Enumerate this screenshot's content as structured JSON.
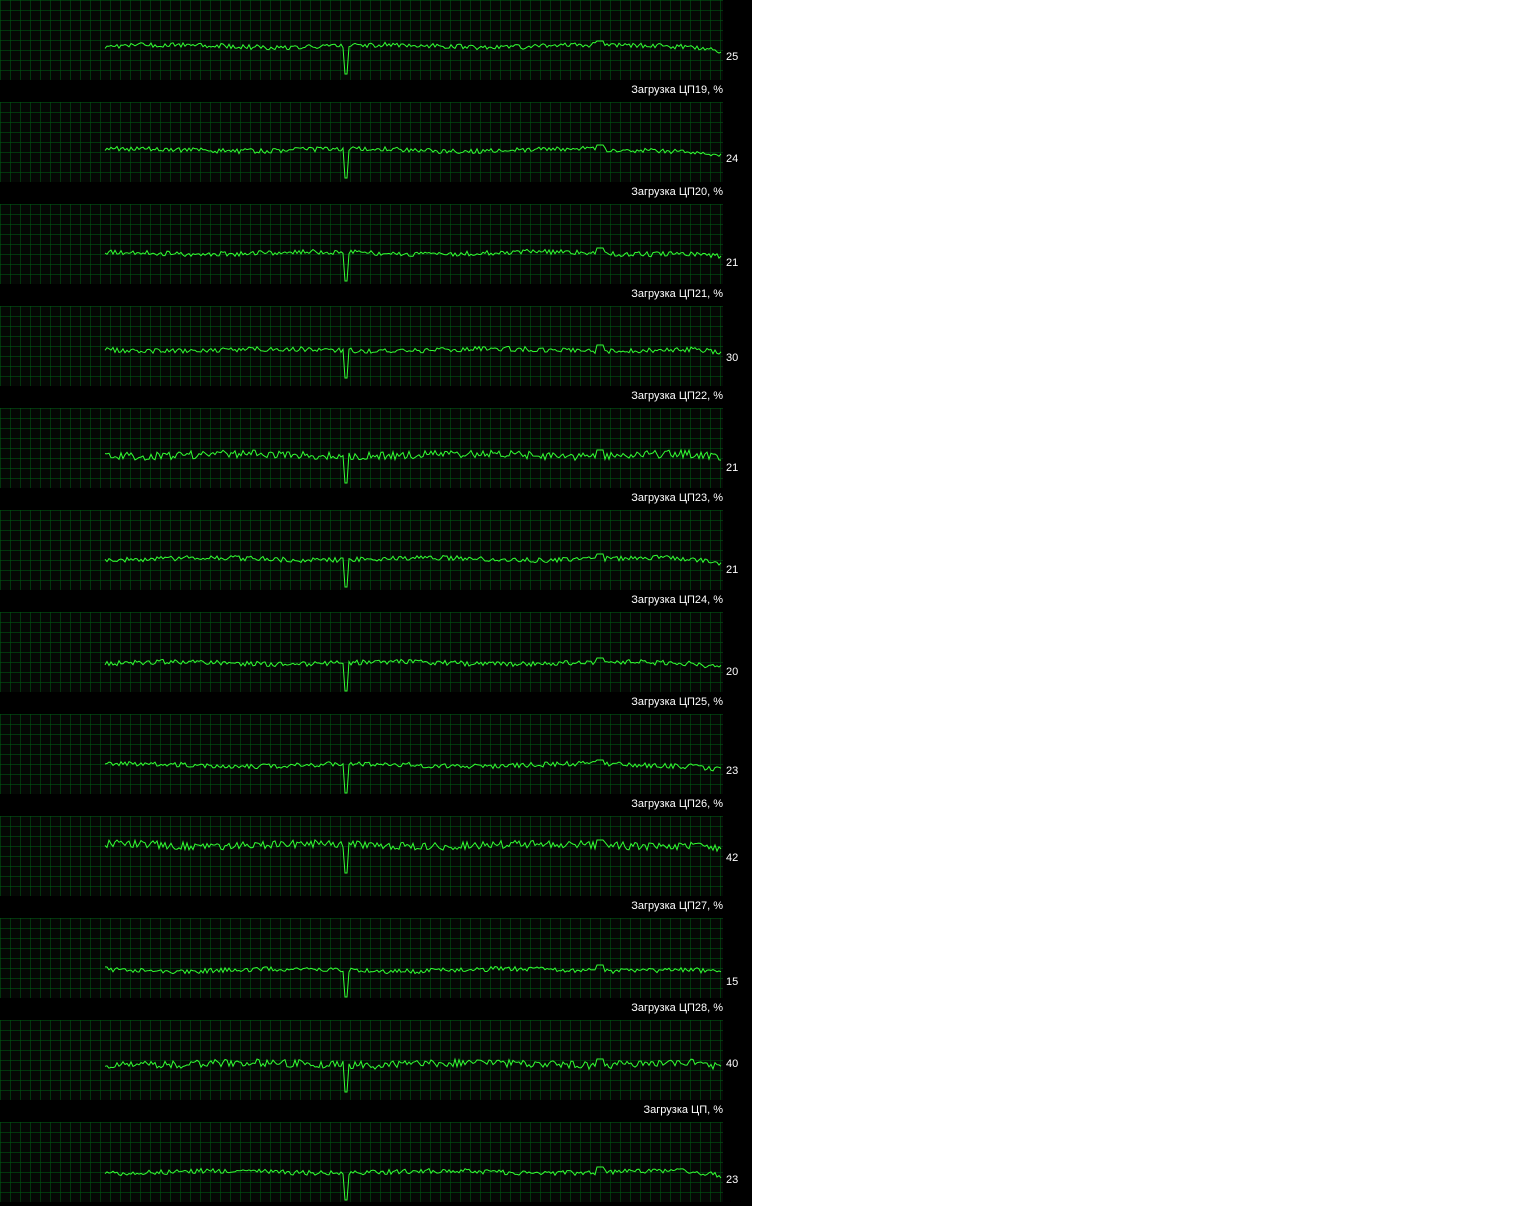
{
  "colors": {
    "background": "#000000",
    "grid": "#0b3a12",
    "line": "#33ff33",
    "text": "#ffffff"
  },
  "graphs": [
    {
      "current_value": "25",
      "title_below": "Загрузка ЦП19, %"
    },
    {
      "current_value": "24",
      "title_below": "Загрузка ЦП20, %"
    },
    {
      "current_value": "21",
      "title_below": "Загрузка ЦП21, %"
    },
    {
      "current_value": "30",
      "title_below": "Загрузка ЦП22, %"
    },
    {
      "current_value": "21",
      "title_below": "Загрузка ЦП23, %"
    },
    {
      "current_value": "21",
      "title_below": "Загрузка ЦП24, %"
    },
    {
      "current_value": "20",
      "title_below": "Загрузка ЦП25, %"
    },
    {
      "current_value": "23",
      "title_below": "Загрузка ЦП26, %"
    },
    {
      "current_value": "42",
      "title_below": "Загрузка ЦП27, %"
    },
    {
      "current_value": "15",
      "title_below": "Загрузка ЦП28, %"
    },
    {
      "current_value": "40",
      "title_below": "Загрузка ЦП, %"
    },
    {
      "current_value": "23",
      "title_below": ""
    }
  ]
}
